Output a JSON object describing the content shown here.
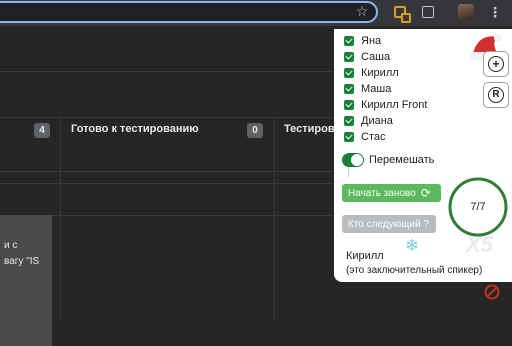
{
  "toolbar": {
    "icons": [
      "star-icon",
      "extension-icon",
      "puzzle-icon",
      "profile-avatar",
      "menu-icon"
    ],
    "menu_glyph": "⋮"
  },
  "board": {
    "columns": [
      {
        "title": "",
        "count": "4"
      },
      {
        "title": "Готово к тестированию",
        "count": "0"
      },
      {
        "title": "Тестирова",
        "count": ""
      }
    ],
    "card_lines": [
      "и с",
      "вагу \"IS"
    ]
  },
  "popup": {
    "members": [
      "Яна",
      "Саша",
      "Кирилл",
      "Маша",
      "Кирилл Front",
      "Диана",
      "Стас"
    ],
    "shuffle_label": "Перемешать",
    "shuffle_on": true,
    "restart_label": "Начать заново",
    "next_label": "Кто следующий ?",
    "progress_text": "7/7",
    "progress_fraction": 1,
    "watermark": "X5",
    "current_speaker": "Кирилл",
    "current_note": "(это заключительный спикер)",
    "add_button_glyph": "+",
    "r_button_glyph": "R"
  },
  "colors": {
    "checkbox": "#1a7f37",
    "restart_button": "#5cb85c",
    "next_button": "#b9bcbf",
    "ring": "#2e7d32",
    "omnibox_focus": "#8ab4f8",
    "ban_icon": "#d93025"
  }
}
